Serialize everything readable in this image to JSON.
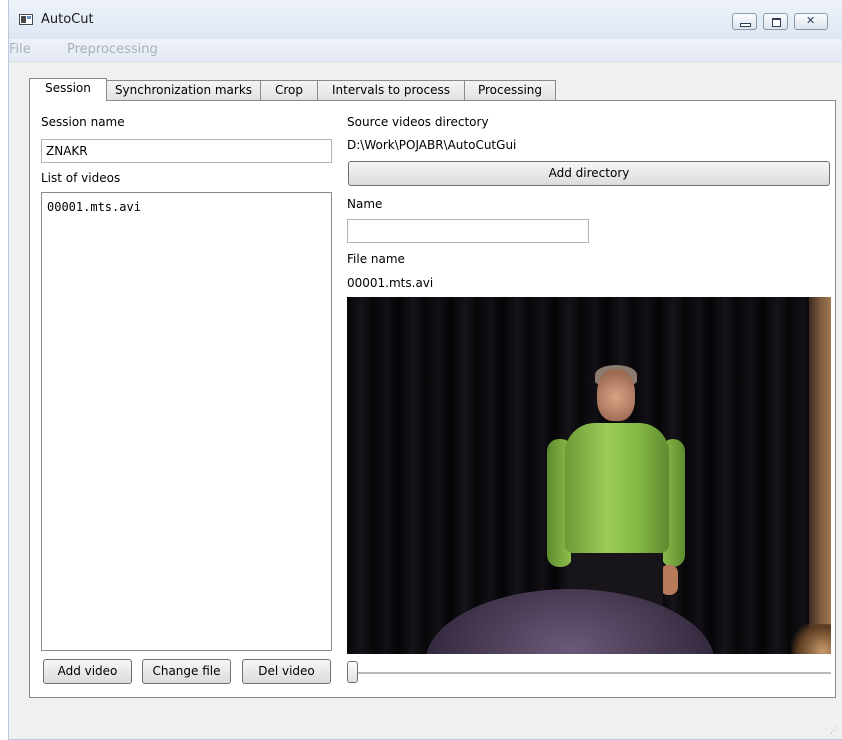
{
  "window": {
    "title": "AutoCut"
  },
  "menu": {
    "items": [
      "File",
      "Preprocessing"
    ]
  },
  "tabs": [
    {
      "label": "Session",
      "active": true
    },
    {
      "label": "Synchronization marks",
      "active": false
    },
    {
      "label": "Crop",
      "active": false
    },
    {
      "label": "Intervals to process",
      "active": false
    },
    {
      "label": "Processing",
      "active": false
    }
  ],
  "session": {
    "session_name_label": "Session name",
    "session_name_value": "ZNAKR",
    "list_label": "List of videos",
    "videos": [
      "00001.mts.avi"
    ],
    "buttons": {
      "add": "Add video",
      "change": "Change file",
      "del": "Del video"
    }
  },
  "source": {
    "dir_label": "Source videos directory",
    "dir_value": "D:\\Work\\POJABR\\AutoCutGui",
    "add_dir_label": "Add directory",
    "name_label": "Name",
    "name_value": "",
    "file_name_label": "File name",
    "file_name_value": "00001.mts.avi"
  },
  "player": {
    "position_fraction": 0
  },
  "colors": {
    "accent_green_shirt": "#9ccd58",
    "panel_border": "#8a8a8a",
    "menu_text_disabled": "#a7b1bd"
  }
}
